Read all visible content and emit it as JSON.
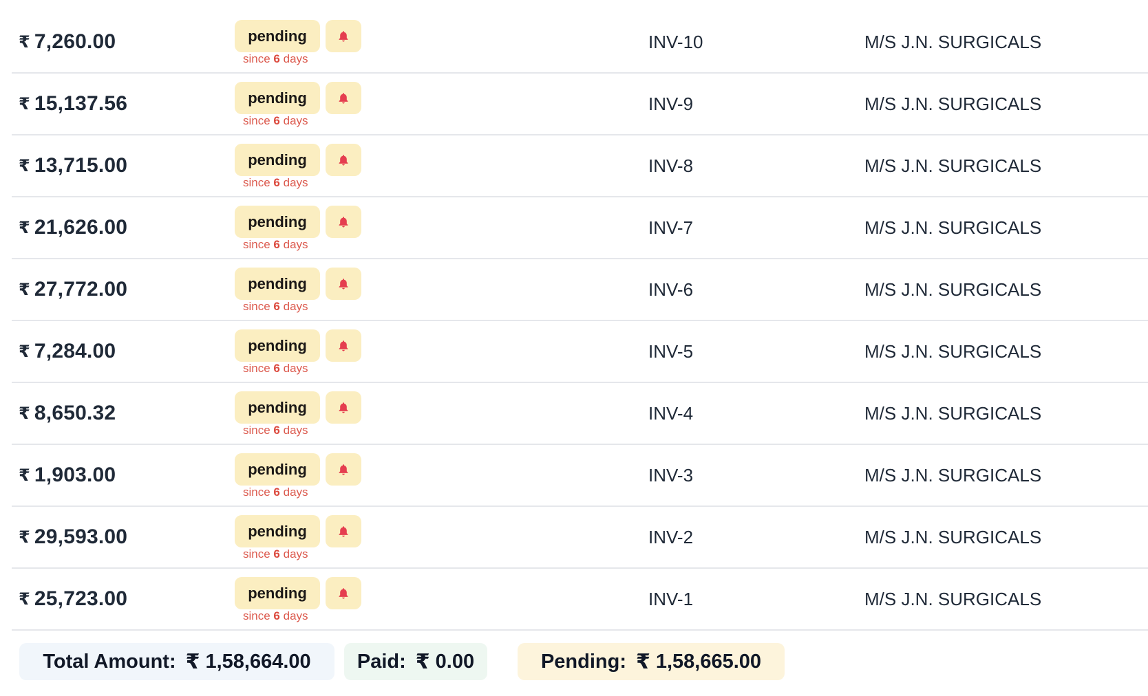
{
  "currency_symbol": "₹",
  "rows": [
    {
      "amount": "7,260.00",
      "status": "pending",
      "since_prefix": "since",
      "since_value": "6",
      "since_suffix": "days",
      "invoice": "INV-10",
      "customer": "M/S J.N. SURGICALS"
    },
    {
      "amount": "15,137.56",
      "status": "pending",
      "since_prefix": "since",
      "since_value": "6",
      "since_suffix": "days",
      "invoice": "INV-9",
      "customer": "M/S J.N. SURGICALS"
    },
    {
      "amount": "13,715.00",
      "status": "pending",
      "since_prefix": "since",
      "since_value": "6",
      "since_suffix": "days",
      "invoice": "INV-8",
      "customer": "M/S J.N. SURGICALS"
    },
    {
      "amount": "21,626.00",
      "status": "pending",
      "since_prefix": "since",
      "since_value": "6",
      "since_suffix": "days",
      "invoice": "INV-7",
      "customer": "M/S J.N. SURGICALS"
    },
    {
      "amount": "27,772.00",
      "status": "pending",
      "since_prefix": "since",
      "since_value": "6",
      "since_suffix": "days",
      "invoice": "INV-6",
      "customer": "M/S J.N. SURGICALS"
    },
    {
      "amount": "7,284.00",
      "status": "pending",
      "since_prefix": "since",
      "since_value": "6",
      "since_suffix": "days",
      "invoice": "INV-5",
      "customer": "M/S J.N. SURGICALS"
    },
    {
      "amount": "8,650.32",
      "status": "pending",
      "since_prefix": "since",
      "since_value": "6",
      "since_suffix": "days",
      "invoice": "INV-4",
      "customer": "M/S J.N. SURGICALS"
    },
    {
      "amount": "1,903.00",
      "status": "pending",
      "since_prefix": "since",
      "since_value": "6",
      "since_suffix": "days",
      "invoice": "INV-3",
      "customer": "M/S J.N. SURGICALS"
    },
    {
      "amount": "29,593.00",
      "status": "pending",
      "since_prefix": "since",
      "since_value": "6",
      "since_suffix": "days",
      "invoice": "INV-2",
      "customer": "M/S J.N. SURGICALS"
    },
    {
      "amount": "25,723.00",
      "status": "pending",
      "since_prefix": "since",
      "since_value": "6",
      "since_suffix": "days",
      "invoice": "INV-1",
      "customer": "M/S J.N. SURGICALS"
    }
  ],
  "icons": {
    "reminder": "bell-icon"
  },
  "colors": {
    "pill_bg": "#fbeec1",
    "bell": "#e53e4f",
    "since_text": "#dc5a4e",
    "total_bg": "#f1f6fb",
    "paid_bg": "#eef7f1",
    "pending_bg": "#fdf4dc"
  },
  "totals": {
    "total_label": "Total Amount:",
    "total_value": "1,58,664.00",
    "paid_label": "Paid:",
    "paid_value": "0.00",
    "pending_label": "Pending:",
    "pending_value": "1,58,665.00"
  }
}
